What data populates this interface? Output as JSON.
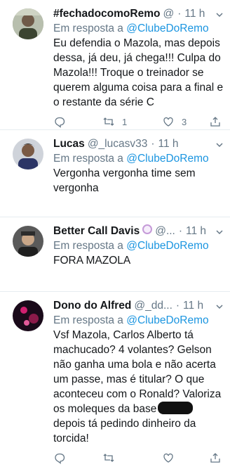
{
  "tweets": [
    {
      "display_name": "#fechadocomoRemo",
      "handle": "@",
      "time": "11 h",
      "reply_prefix": "Em resposta a",
      "reply_to": "@ClubeDoRemo",
      "text": "Eu defendia o Mazola, mas depois dessa, já deu, já  chega!!! Culpa do Mazola!!! Troque o treinador se querem alguma coisa para a final e o restante da série C",
      "replies": "",
      "retweets": "1",
      "likes": "3"
    },
    {
      "display_name": "Lucas",
      "handle": "@_lucasv33",
      "time": "11 h",
      "reply_prefix": "Em resposta a",
      "reply_to": "@ClubeDoRemo",
      "text": "Vergonha vergonha time sem vergonha"
    },
    {
      "display_name": "Better Call Davis",
      "handle": "@...",
      "time": "11 h",
      "reply_prefix": "Em resposta a",
      "reply_to": "@ClubeDoRemo",
      "text": "FORA MAZOLA"
    },
    {
      "display_name": "Dono do Alfred",
      "handle": "@_dd...",
      "time": "11 h",
      "reply_prefix": "Em resposta a",
      "reply_to": "@ClubeDoRemo",
      "text_before": "Vsf Mazola, Carlos Alberto tá machucado? 4 volantes? Gelson não ganha uma bola e não acerta um passe, mas é titular? O que aconteceu com o Ronald? Valoriza os moleques da base",
      "text_after": "depois tá pedindo dinheiro da torcida!"
    }
  ],
  "icons": {
    "reply": "reply-icon",
    "retweet": "retweet-icon",
    "like": "heart-icon",
    "share": "share-icon",
    "more": "chevron-down-icon"
  },
  "colors": {
    "link": "#1b95e0",
    "muted": "#657786",
    "divider": "#e6ecf0"
  }
}
